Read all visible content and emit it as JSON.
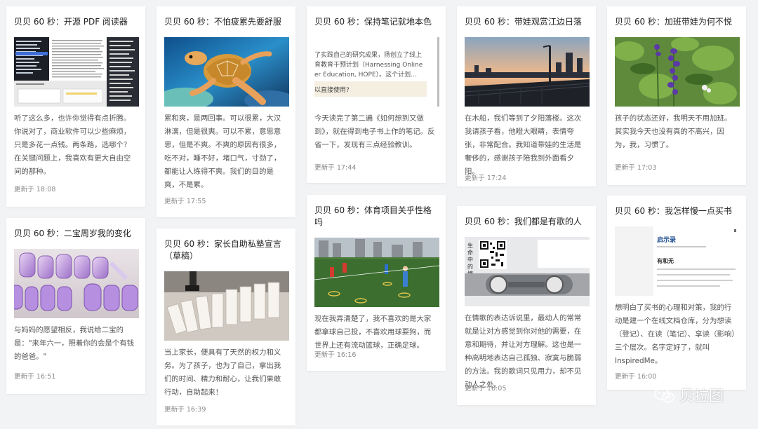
{
  "cards": [
    {
      "title": "贝贝 60 秒：开源 PDF 阅读器",
      "excerpt": "听了这么多，也许你觉得有点折腾。你说对了，商业软件可以少些麻烦，只是多花一点钱。两条路，选哪个？ 在关键问题上，我喜欢有更大自由空间的那种。",
      "time": "更新于 18:08",
      "thumb": "pdf-reader-screenshot"
    },
    {
      "title": "贝贝 60 秒：二宝周岁我的变化",
      "excerpt": "与妈妈的愿望相反，我说给二宝的是：\"来年六一，照着你的会是个有钱的爸爸。\"",
      "time": "更新于 16:51",
      "thumb": "happy-birthday-balloons-photo"
    },
    {
      "title": "贝贝 60 秒：不怕疲累先要舒服",
      "excerpt": "累和爽，是两回事。可以很累，大汉淋漓，但是很爽。可以不累，意思意思，但是不爽。不爽的原因有很多，吃不对，睡不好，堵口气，寸劲了，都能让人练得不爽。我们的目的是爽，不是累。",
      "time": "更新于 17:55",
      "thumb": "sea-turtle-photo"
    },
    {
      "title": "贝贝 60 秒：家长自助私塾宣言（草稿）",
      "excerpt": "当上家长，便具有了天然的权力和义务。为了孩子，也为了自己，拿出我们的时间、精力和耐心，让我们果敢行动，自助起来！",
      "time": "更新于 16:39",
      "thumb": "paper-dominoes-photo"
    },
    {
      "title": "贝贝 60 秒：保持笔记就地本色",
      "excerpt": "今天读完了第二遍《如何想到又做到》，就在得到电子书上作的笔记。反省一下，发现有三点经验教训。",
      "time": "更新于 17:44",
      "thumb": "ebook-note-screenshot",
      "thumb_lines": [
        "了实践自己的研究成果，扬创立了线上",
        "育教育干预计划（Harnessing Online",
        "er Education, HOPE）。这个计划…",
        "以直接使用?"
      ]
    },
    {
      "title": "贝贝 60 秒：体育项目关乎性格吗",
      "excerpt": "现在我弄清楚了，我不喜欢的是大家都拿球自己投，不喜欢用球耍狗，而世界上还有流动篮球，正确足球。",
      "time": "更新于 16:16",
      "thumb": "kids-football-field-photo"
    },
    {
      "title": "贝贝 60 秒：带娃观赏江边日落",
      "excerpt": "在木船，我们等到了夕阳落楼。这次我请孩子看，他瞪大眼睛，表情夸张，非常配合。我知道带娃的生活是奢侈的，感谢孩子陪我到外面看夕阳。",
      "time": "更新于 17:24",
      "thumb": "riverside-sunset-photo"
    },
    {
      "title": "贝贝 60 秒：我们都是有歌的人",
      "excerpt": "在情歌的表达诉说里，最动人的常常就是让对方感觉到你对他的需要，在意和期待，并让对方理解。这也是一种高明地表达自己孤独、寂寞与脆弱的方法。我的歌词只见用力，却不见动人之处。",
      "time": "更新于 16:05",
      "thumb": "qr-code-card",
      "thumb_text": "生命中的摘美"
    },
    {
      "title": "贝贝 60 秒：加班带娃为何不悦",
      "excerpt": "孩子的状态还好，我明天不用加班。其实我今天也没有真的不高兴，因为，我，习惯了。",
      "time": "更新于 17:03",
      "thumb": "purple-flowers-photo"
    },
    {
      "title": "贝贝 60 秒：我怎样慢一点买书",
      "excerpt": "想明白了买书的心理和对策，我的行动是建一个在线文档仓库，分为想读（登记）、在读（笔记）、享读（影响）三个层次。名字定好了，就叫 InspiredMe。",
      "time": "更新于 16:00",
      "thumb": "document-screenshot",
      "thumb_lines": [
        "启示录",
        "有和无"
      ]
    }
  ],
  "watermark": {
    "text": "贝拉图",
    "icon": "wechat-icon"
  }
}
